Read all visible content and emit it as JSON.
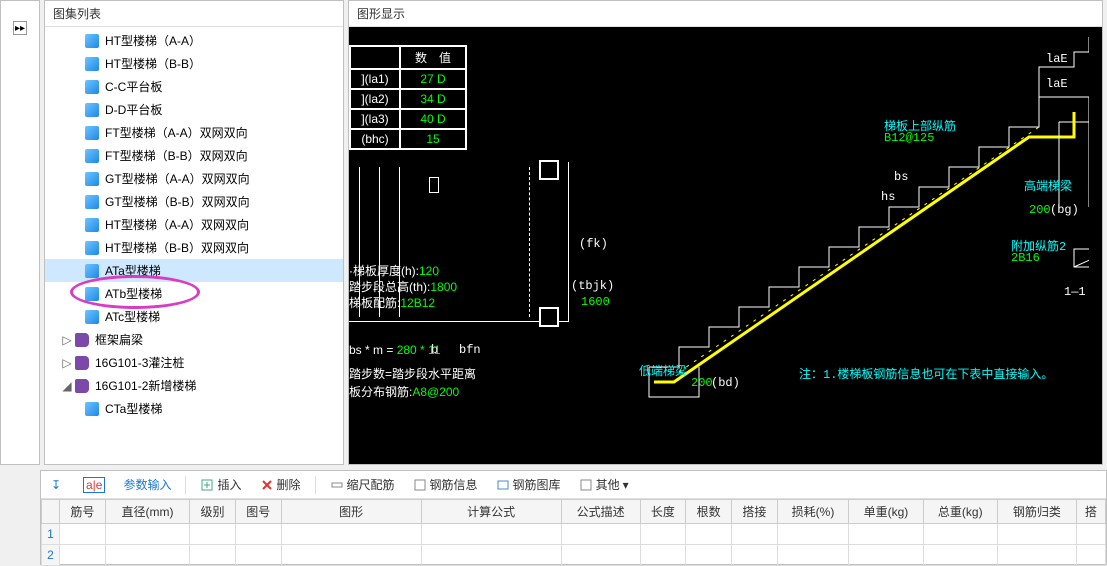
{
  "panels": {
    "tree_title": "图集列表",
    "display_title": "图形显示"
  },
  "tree": {
    "items": [
      "HT型楼梯（A-A）",
      "HT型楼梯（B-B）",
      "C-C平台板",
      "D-D平台板",
      "FT型楼梯（A-A）双网双向",
      "FT型楼梯（B-B）双网双向",
      "GT型楼梯（A-A）双网双向",
      "GT型楼梯（B-B）双网双向",
      "HT型楼梯（A-A）双网双向",
      "HT型楼梯（B-B）双网双向",
      "ATa型楼梯",
      "ATb型楼梯",
      "ATc型楼梯"
    ],
    "groups": [
      {
        "toggle": "▷",
        "label": "框架扁梁"
      },
      {
        "toggle": "▷",
        "label": "16G101-3灌注桩"
      },
      {
        "toggle": "◢",
        "label": "16G101-2新增楼梯"
      }
    ],
    "sub_items": [
      "CTa型楼梯"
    ]
  },
  "cad": {
    "table": {
      "header": "数　值",
      "rows": [
        {
          "lbl": "](la1)",
          "val": "27 D"
        },
        {
          "lbl": "](la2)",
          "val": "34 D"
        },
        {
          "lbl": "](la3)",
          "val": "40 D"
        },
        {
          "lbl": "(bhc)",
          "val": "15"
        }
      ]
    },
    "params": [
      {
        "label": "·梯板厚度(h):",
        "value": "120"
      },
      {
        "label": "踏步段总高(th):",
        "value": "1800"
      },
      {
        "label": "梯板配筋:",
        "value": "12B12"
      },
      {
        "label": "踏步数=踏步段水平距离",
        "value": ""
      },
      {
        "label": "板分布钢筋:",
        "value": "A8@200"
      }
    ],
    "plan_labels": {
      "fk": "(fk)",
      "tbjk": "(tbjk)",
      "tbjk_val": "1600",
      "bfn": "bfn",
      "bs_m": "bs * m = ",
      "bs_m_val": "280 * 11",
      "b": "b"
    },
    "stair": {
      "top_rebar": "梯板上部纵筋",
      "top_rebar_val": "B12@125",
      "high_beam": "高端梯梁",
      "laE1": "laE",
      "laE2": "laE",
      "bs": "bs",
      "hs": "hs",
      "bg": "(bg)",
      "bg_val": "200",
      "add_rebar": "附加纵筋2",
      "add_rebar_val": "2B16",
      "section": "1—1",
      "low_beam": "低端梯梁",
      "bd": "(bd)",
      "bd_val": "200",
      "note": "注：1.楼梯板钢筋信息也可在下表中直接输入。"
    }
  },
  "toolbar": {
    "down_icon": "↧",
    "ab_icon": "a|e",
    "param_input": "参数输入",
    "insert": "插入",
    "delete": "删除",
    "scale": "缩尺配筋",
    "rebar_info": "钢筋信息",
    "rebar_lib": "钢筋图库",
    "other": "其他"
  },
  "grid": {
    "headers": [
      "筋号",
      "直径(mm)",
      "级别",
      "图号",
      "图形",
      "计算公式",
      "公式描述",
      "长度",
      "根数",
      "搭接",
      "损耗(%)",
      "单重(kg)",
      "总重(kg)",
      "钢筋归类",
      "搭"
    ],
    "rownums": [
      "1",
      "2"
    ]
  }
}
